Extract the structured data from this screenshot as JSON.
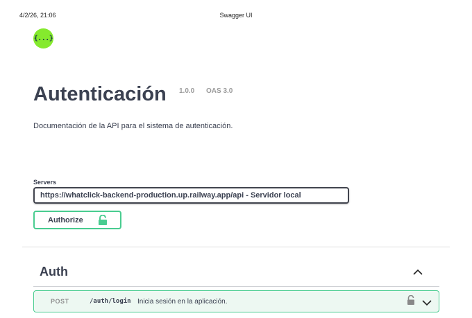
{
  "print_header": {
    "datetime": "4/2/26, 21:06",
    "page_title": "Swagger UI"
  },
  "logo": {
    "glyph": "{...}",
    "icon": "swagger-logo-icon",
    "color": "#85ea2d"
  },
  "info": {
    "title": "Autenticación",
    "version": "1.0.0",
    "oas": "OAS 3.0",
    "description": "Documentación de la API para el sistema de autenticación."
  },
  "servers": {
    "label": "Servers",
    "selected": "https://whatclick-backend-production.up.railway.app/api - Servidor local"
  },
  "authorize": {
    "label": "Authorize",
    "icon": "unlocked-icon",
    "color": "#49cc90"
  },
  "tags": [
    {
      "name": "Auth",
      "expanded": true,
      "operations": [
        {
          "method": "POST",
          "path": "/auth/login",
          "summary": "Inicia sesión en la aplicación.",
          "color": "#49cc90"
        }
      ]
    }
  ]
}
